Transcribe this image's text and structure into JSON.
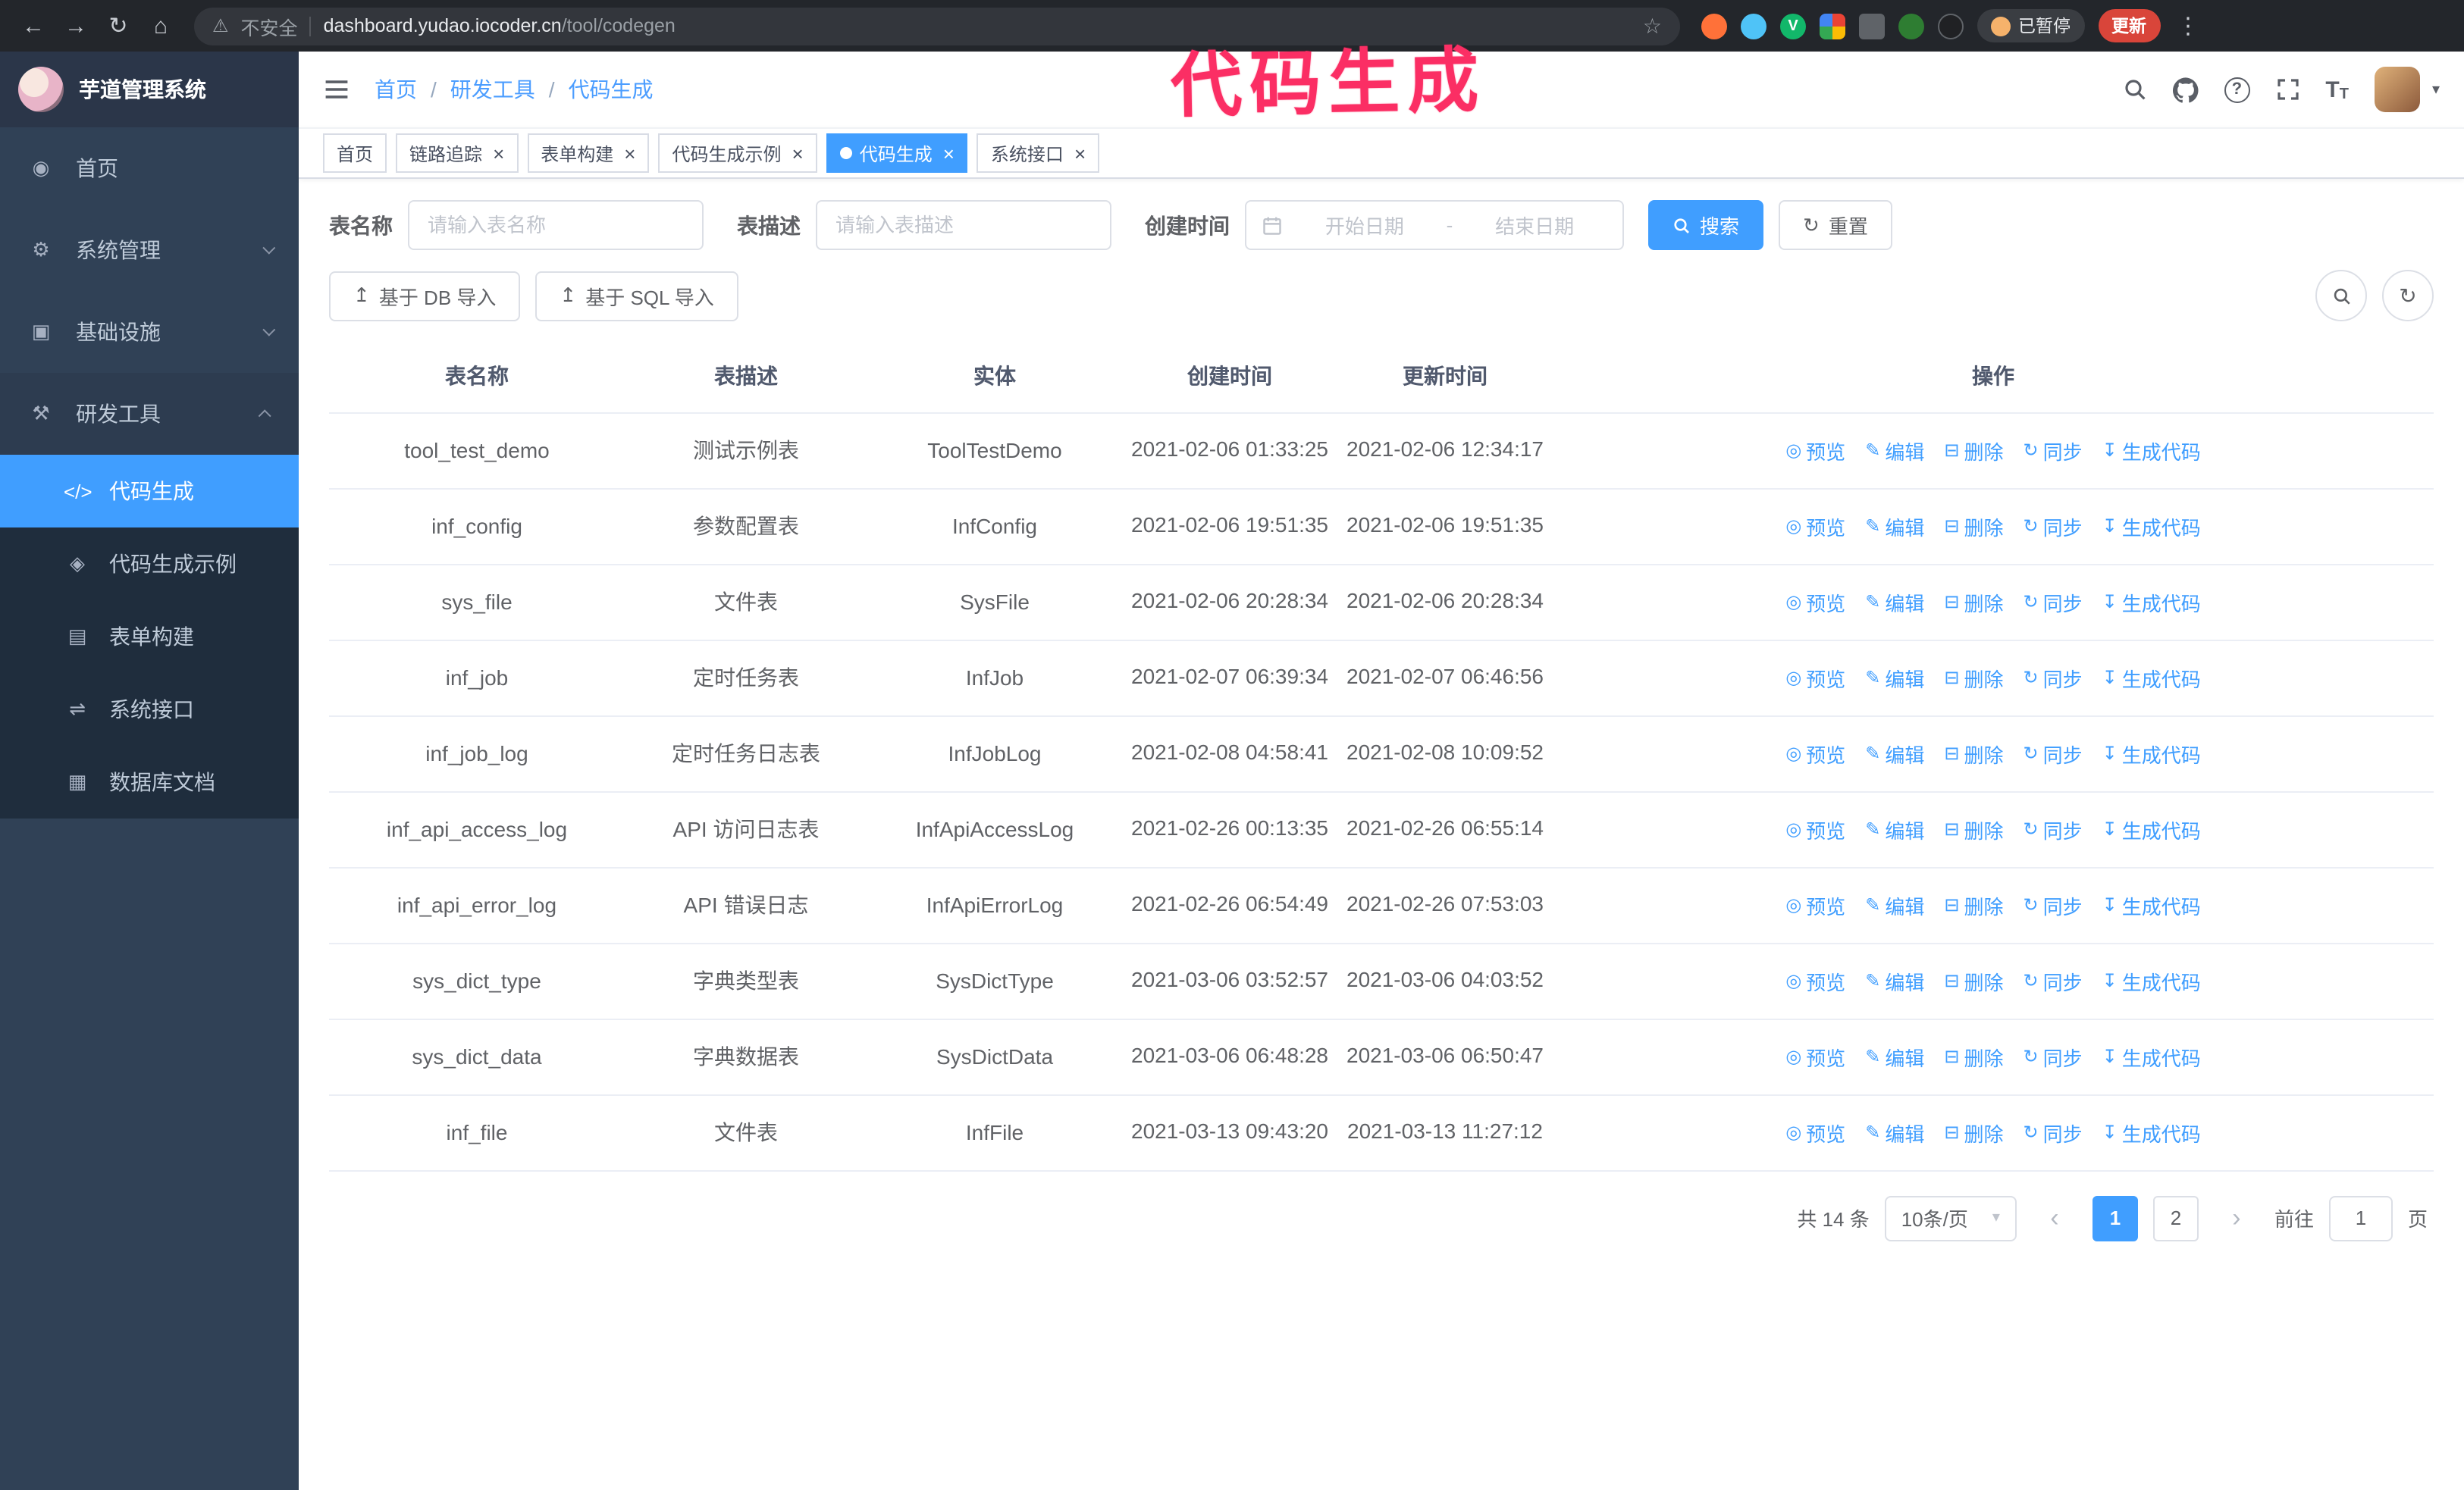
{
  "browser": {
    "security_label": "不安全",
    "url_host": "dashboard.yudao.iocoder.cn",
    "url_path": "/tool/codegen",
    "paused_badge": "已暂停",
    "update_button": "更新"
  },
  "annotation": "代码生成",
  "sidebar": {
    "logo_title": "芋道管理系统",
    "items": [
      {
        "label": "首页"
      },
      {
        "label": "系统管理"
      },
      {
        "label": "基础设施"
      },
      {
        "label": "研发工具"
      }
    ],
    "subitems": [
      {
        "label": "代码生成"
      },
      {
        "label": "代码生成示例"
      },
      {
        "label": "表单构建"
      },
      {
        "label": "系统接口"
      },
      {
        "label": "数据库文档"
      }
    ]
  },
  "breadcrumb": {
    "items": [
      "首页",
      "研发工具",
      "代码生成"
    ],
    "separator": "/"
  },
  "tabs": [
    {
      "label": "首页",
      "closable": false,
      "active": false
    },
    {
      "label": "链路追踪",
      "closable": true,
      "active": false
    },
    {
      "label": "表单构建",
      "closable": true,
      "active": false
    },
    {
      "label": "代码生成示例",
      "closable": true,
      "active": false
    },
    {
      "label": "代码生成",
      "closable": true,
      "active": true
    },
    {
      "label": "系统接口",
      "closable": true,
      "active": false
    }
  ],
  "filters": {
    "name_label": "表名称",
    "name_placeholder": "请输入表名称",
    "desc_label": "表描述",
    "desc_placeholder": "请输入表描述",
    "time_label": "创建时间",
    "start_placeholder": "开始日期",
    "separator": "-",
    "end_placeholder": "结束日期",
    "search": "搜索",
    "reset": "重置"
  },
  "toolbar": {
    "import_db": "基于 DB 导入",
    "import_sql": "基于 SQL 导入"
  },
  "table": {
    "columns": [
      "表名称",
      "表描述",
      "实体",
      "创建时间",
      "更新时间",
      "操作"
    ],
    "actions": [
      {
        "label": "预览",
        "icon": "preview",
        "glyph": "◎"
      },
      {
        "label": "编辑",
        "icon": "edit",
        "glyph": "✎"
      },
      {
        "label": "删除",
        "icon": "delete",
        "glyph": "⊟"
      },
      {
        "label": "同步",
        "icon": "sync",
        "glyph": "↻"
      },
      {
        "label": "生成代码",
        "icon": "generate-code",
        "glyph": "↧"
      }
    ],
    "rows": [
      {
        "name": "tool_test_demo",
        "desc": "测试示例表",
        "entity": "ToolTestDemo",
        "created": "2021-02-06 01:33:25",
        "updated": "2021-02-06 12:34:17"
      },
      {
        "name": "inf_config",
        "desc": "参数配置表",
        "entity": "InfConfig",
        "created": "2021-02-06 19:51:35",
        "updated": "2021-02-06 19:51:35"
      },
      {
        "name": "sys_file",
        "desc": "文件表",
        "entity": "SysFile",
        "created": "2021-02-06 20:28:34",
        "updated": "2021-02-06 20:28:34"
      },
      {
        "name": "inf_job",
        "desc": "定时任务表",
        "entity": "InfJob",
        "created": "2021-02-07 06:39:34",
        "updated": "2021-02-07 06:46:56"
      },
      {
        "name": "inf_job_log",
        "desc": "定时任务日志表",
        "entity": "InfJobLog",
        "created": "2021-02-08 04:58:41",
        "updated": "2021-02-08 10:09:52"
      },
      {
        "name": "inf_api_access_log",
        "desc": "API 访问日志表",
        "entity": "InfApiAccessLog",
        "created": "2021-02-26 00:13:35",
        "updated": "2021-02-26 06:55:14"
      },
      {
        "name": "inf_api_error_log",
        "desc": "API 错误日志",
        "entity": "InfApiErrorLog",
        "created": "2021-02-26 06:54:49",
        "updated": "2021-02-26 07:53:03"
      },
      {
        "name": "sys_dict_type",
        "desc": "字典类型表",
        "entity": "SysDictType",
        "created": "2021-03-06 03:52:57",
        "updated": "2021-03-06 04:03:52"
      },
      {
        "name": "sys_dict_data",
        "desc": "字典数据表",
        "entity": "SysDictData",
        "created": "2021-03-06 06:48:28",
        "updated": "2021-03-06 06:50:47"
      },
      {
        "name": "inf_file",
        "desc": "文件表",
        "entity": "InfFile",
        "created": "2021-03-13 09:43:20",
        "updated": "2021-03-13 11:27:12"
      }
    ]
  },
  "pagination": {
    "total": "共 14 条",
    "page_size": "10条/页",
    "pages": [
      "1",
      "2"
    ],
    "goto_label": "前往",
    "goto_value": "1",
    "unit_label": "页"
  },
  "colors": {
    "primary": "#409eff",
    "sidebar_bg": "#304156",
    "submenu_bg": "#1f2d3d",
    "annotation": "#fb2e64",
    "update_button": "#d9453a"
  }
}
